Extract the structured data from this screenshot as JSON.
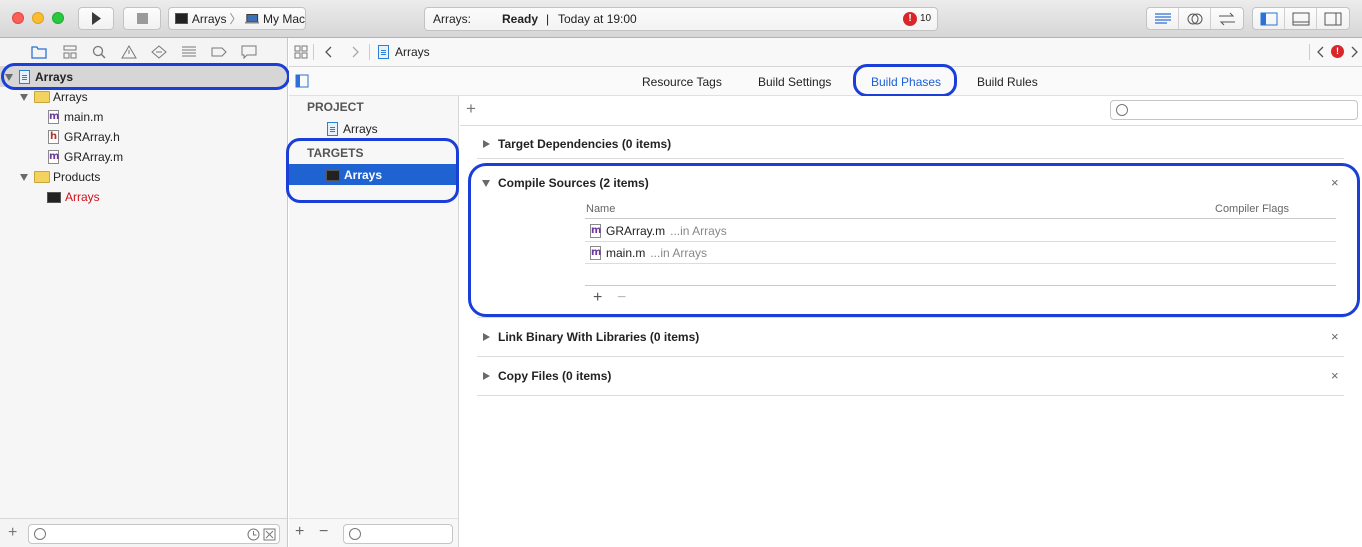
{
  "toolbar": {
    "scheme_target": "Arrays",
    "scheme_destination": "My Mac",
    "status_project": "Arrays:",
    "status_state": "Ready",
    "status_separator": "|",
    "status_time": "Today at 19:00",
    "issue_count": "10"
  },
  "navigator": {
    "project": "Arrays",
    "group": "Arrays",
    "files": [
      "main.m",
      "GRArray.h",
      "GRArray.m"
    ],
    "products_group": "Products",
    "product": "Arrays"
  },
  "jumpbar": {
    "breadcrumb": "Arrays"
  },
  "tabs": {
    "resource_tags": "Resource Tags",
    "build_settings": "Build Settings",
    "build_phases": "Build Phases",
    "build_rules": "Build Rules"
  },
  "target_list": {
    "project_header": "PROJECT",
    "project_item": "Arrays",
    "targets_header": "TARGETS",
    "target_item": "Arrays"
  },
  "phases": {
    "add": "+",
    "target_dependencies": "Target Dependencies (0 items)",
    "compile_sources": "Compile Sources (2 items)",
    "col_name": "Name",
    "col_flags": "Compiler Flags",
    "sources": [
      {
        "file": "GRArray.m",
        "location": "...in Arrays"
      },
      {
        "file": "main.m",
        "location": "...in Arrays"
      }
    ],
    "link_binary": "Link Binary With Libraries (0 items)",
    "copy_files": "Copy Files (0 items)",
    "close": "×",
    "plus": "+",
    "minus": "−"
  },
  "footer": {
    "plus": "+",
    "minus": "−"
  },
  "colors": {
    "accent": "#1a5fd8",
    "highlight_outline": "#1a3fd9",
    "selection": "#1f63d3"
  }
}
